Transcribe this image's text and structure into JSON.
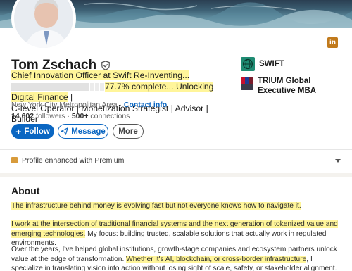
{
  "profile": {
    "name": "Tom Zschach",
    "headline_part1": "Chief Innovation Officer at Swift Re-Inventing...",
    "headline_part2": "77.7% complete... Unlocking Digital Finance",
    "headline_part3": " |",
    "headline_line3": "C-level Operator | Monetization Strategist | Advisor | Builder",
    "location": "New York City Metropolitan Area",
    "separator": " · ",
    "contact_info": "Contact info",
    "followers_count": "14,602",
    "followers_label": " followers · ",
    "connections_count": "500+",
    "connections_label": " connections"
  },
  "actions": {
    "follow": "Follow",
    "follow_plus": "+",
    "message": "Message",
    "more": "More"
  },
  "orgs": [
    {
      "name": "SWIFT",
      "icon": "globe-icon",
      "color": "#1f8c73"
    },
    {
      "name": "TRIUM Global Executive MBA",
      "icon": "trium-logo"
    }
  ],
  "linkedin_badge": "in",
  "premium": {
    "text": "Profile enhanced with Premium"
  },
  "about": {
    "title": "About",
    "p1": "The infrastructure behind money is evolving fast but not everyone knows how to navigate it.",
    "p2a": "I work at the intersection of traditional financial systems and the next generation of tokenized value and emerging technologies.",
    "p2b": " My focus: building trusted, scalable solutions that actually work in regulated environments.",
    "p3a": "Over the years, I've helped global institutions, growth-stage companies and ecosystem partners unlock value at the edge of transformation. ",
    "p3b": "Whether it's AI, blockchain, or cross-border infrastructure",
    "p3c": ", I specialize in translating vision into action without losing sight of scale, safety, or stakeholder alignment."
  },
  "colors": {
    "accent": "#0a66c2",
    "highlight": "#fff59a",
    "premium": "#d89b3b"
  }
}
